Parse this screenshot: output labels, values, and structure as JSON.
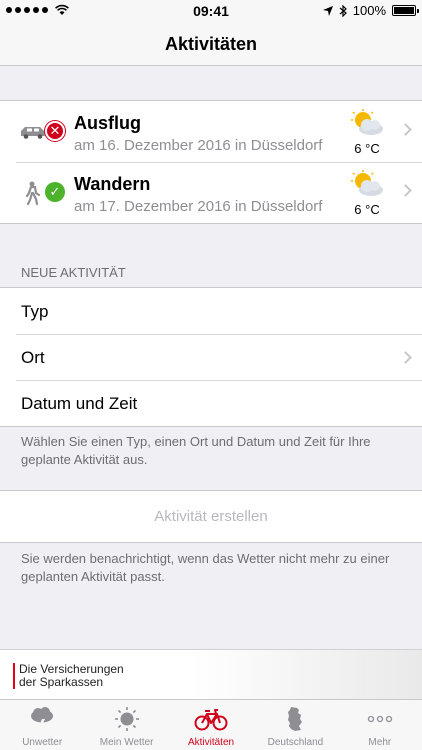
{
  "status_bar": {
    "time": "09:41",
    "battery": "100%"
  },
  "nav": {
    "title": "Aktivitäten"
  },
  "activities": [
    {
      "title": "Ausflug",
      "subtitle": "am 16. Dezember 2016 in Düsseldorf",
      "type_icon": "car-icon",
      "status": "error",
      "status_icon": "x-mark-icon",
      "weather_icon": "sun-behind-cloud-icon",
      "temperature": "6 °C"
    },
    {
      "title": "Wandern",
      "subtitle": "am 17. Dezember 2016 in Düsseldorf",
      "type_icon": "hiker-icon",
      "status": "ok",
      "status_icon": "check-icon",
      "weather_icon": "sun-behind-cloud-icon",
      "temperature": "6 °C"
    }
  ],
  "new_activity": {
    "header": "NEUE AKTIVITÄT",
    "type_label": "Typ",
    "location_label": "Ort",
    "datetime_label": "Datum und Zeit",
    "hint": "Wählen Sie einen Typ, einen Ort und Datum und Zeit für Ihre geplante Aktivität aus.",
    "create_label": "Aktivität erstellen",
    "info": "Sie werden benachrichtigt, wenn das Wetter nicht mehr zu einer geplanten Aktivität passt."
  },
  "ad": {
    "line1": "Die Versicherungen",
    "line2": "der Sparkassen"
  },
  "tabs": [
    {
      "label": "Unwetter",
      "icon": "storm-cloud-icon",
      "active": false
    },
    {
      "label": "Mein Wetter",
      "icon": "sun-icon",
      "active": false
    },
    {
      "label": "Aktivitäten",
      "icon": "bicycle-icon",
      "active": true
    },
    {
      "label": "Deutschland",
      "icon": "germany-map-icon",
      "active": false
    },
    {
      "label": "Mehr",
      "icon": "more-dots-icon",
      "active": false
    }
  ],
  "colors": {
    "accent": "#d0021b",
    "ok": "#4cb32b",
    "secondary_text": "#8e8e93"
  }
}
